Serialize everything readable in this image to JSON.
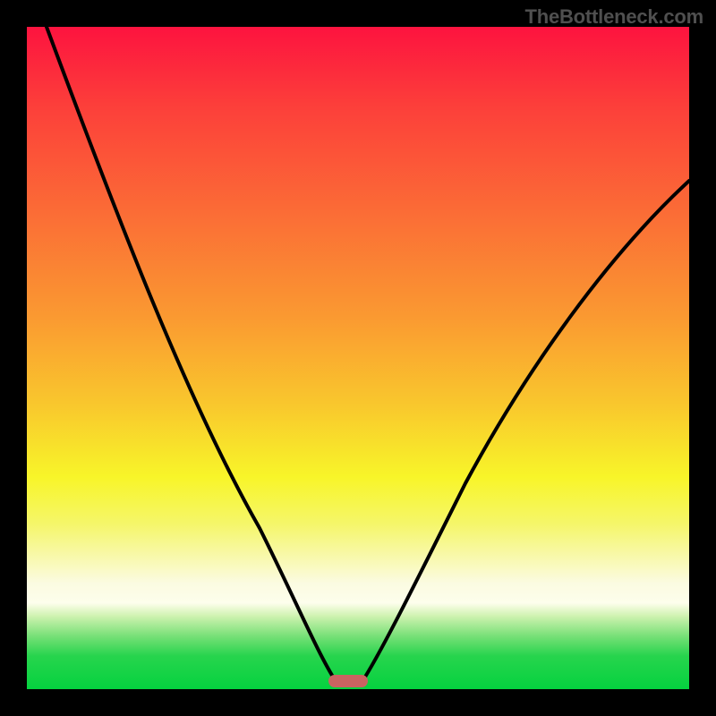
{
  "watermark": "TheBottleneck.com",
  "chart_data": {
    "type": "line",
    "title": "",
    "xlabel": "",
    "ylabel": "",
    "xlim": [
      0,
      100
    ],
    "ylim": [
      0,
      100
    ],
    "series": [
      {
        "name": "left-curve",
        "x": [
          3,
          10,
          18,
          26,
          34,
          40,
          44,
          46,
          47
        ],
        "y": [
          100,
          82,
          64,
          46,
          28,
          14,
          5,
          1,
          0
        ]
      },
      {
        "name": "right-curve",
        "x": [
          50,
          52,
          56,
          62,
          70,
          80,
          90,
          100
        ],
        "y": [
          0,
          3,
          12,
          26,
          44,
          60,
          70,
          77
        ]
      }
    ],
    "annotations": [
      {
        "name": "bottleneck-marker",
        "x": 48.5,
        "y": 1.2
      }
    ],
    "gradient_stops": [
      {
        "pos": 0,
        "color": "#fd133f"
      },
      {
        "pos": 50,
        "color": "#f9c72d"
      },
      {
        "pos": 85,
        "color": "#fbfbe1"
      },
      {
        "pos": 100,
        "color": "#05d23f"
      }
    ]
  },
  "marker_style": {
    "left_pct": 48.5,
    "top_pct": 98.8
  }
}
